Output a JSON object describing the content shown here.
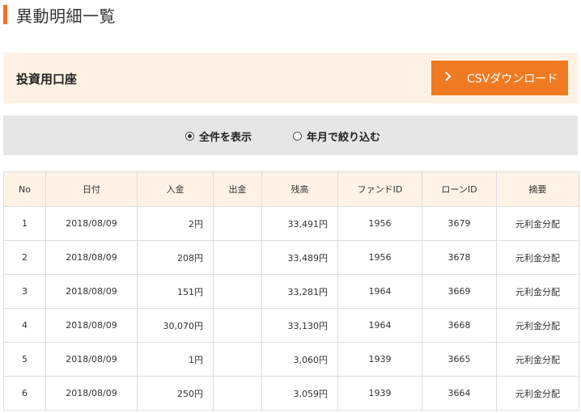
{
  "page": {
    "title": "異動明細一覧"
  },
  "account": {
    "label": "投資用口座",
    "csv_button": "CSVダウンロード"
  },
  "filter": {
    "options": [
      {
        "label": "全件を表示",
        "checked": true
      },
      {
        "label": "年月で絞り込む",
        "checked": false
      }
    ]
  },
  "table": {
    "headers": [
      "No",
      "日付",
      "入金",
      "出金",
      "残高",
      "ファンドID",
      "ローンID",
      "摘要"
    ],
    "rows": [
      [
        "1",
        "2018/08/09",
        "2円",
        "",
        "33,491円",
        "1956",
        "3679",
        "元利金分配"
      ],
      [
        "2",
        "2018/08/09",
        "208円",
        "",
        "33,489円",
        "1956",
        "3678",
        "元利金分配"
      ],
      [
        "3",
        "2018/08/09",
        "151円",
        "",
        "33,281円",
        "1964",
        "3669",
        "元利金分配"
      ],
      [
        "4",
        "2018/08/09",
        "30,070円",
        "",
        "33,130円",
        "1964",
        "3668",
        "元利金分配"
      ],
      [
        "5",
        "2018/08/09",
        "1円",
        "",
        "3,060円",
        "1939",
        "3665",
        "元利金分配"
      ],
      [
        "6",
        "2018/08/09",
        "250円",
        "",
        "3,059円",
        "1939",
        "3664",
        "元利金分配"
      ]
    ]
  },
  "colors": {
    "accent": "#f07a22",
    "panel": "#fff2e4",
    "filter_bg": "#e6e6e6",
    "header_bg": "#fff3e6"
  }
}
